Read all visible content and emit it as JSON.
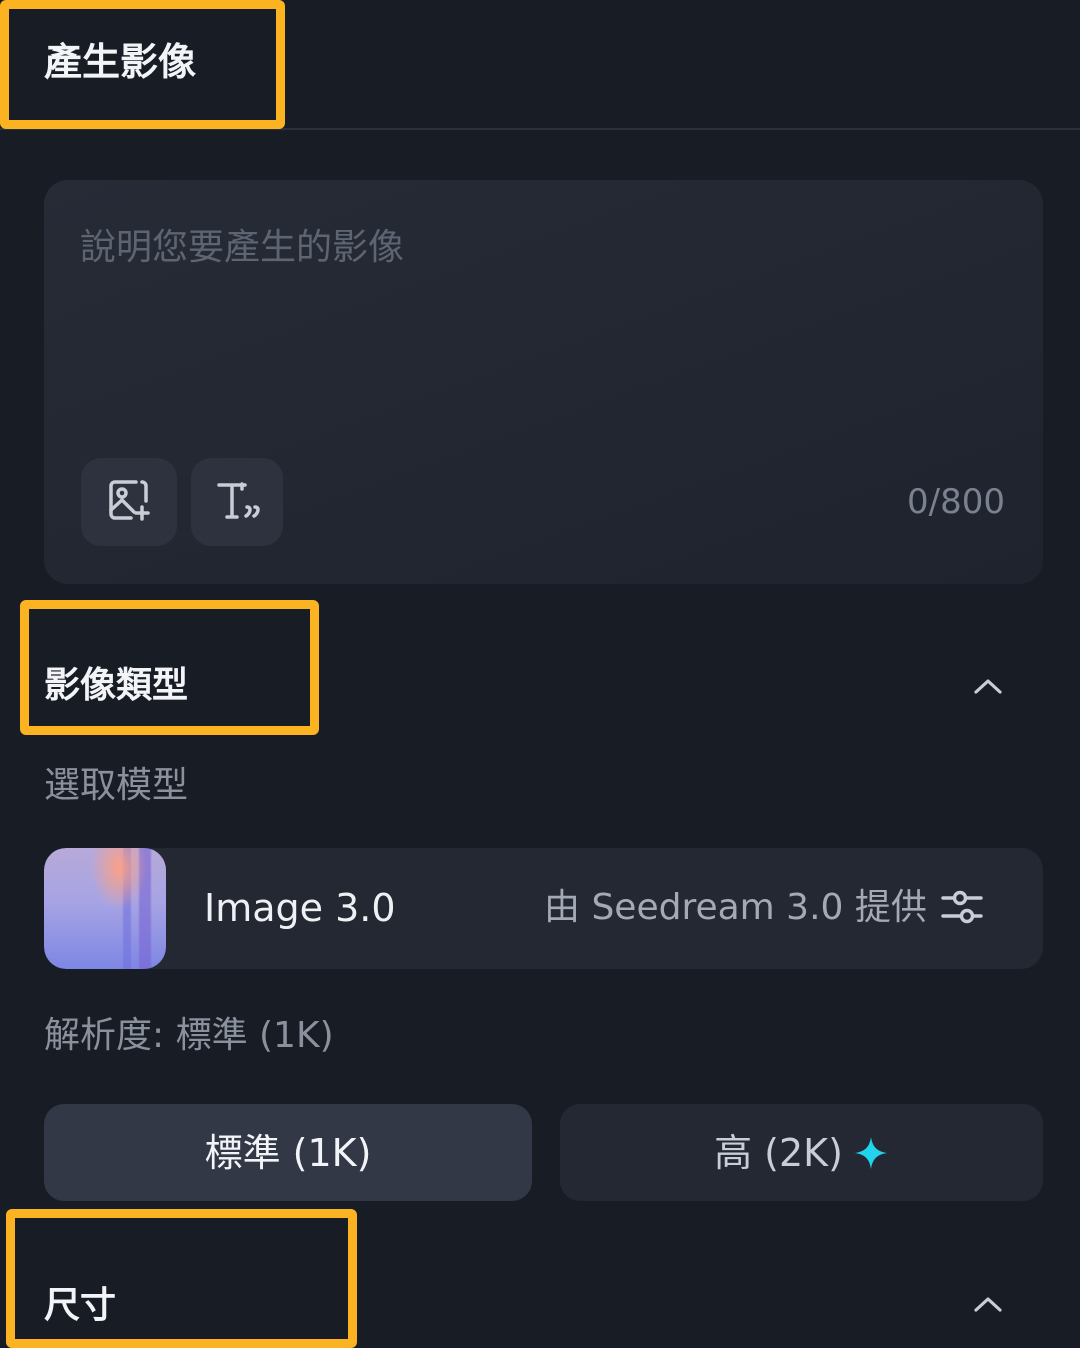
{
  "header": {
    "title": "產生影像"
  },
  "prompt": {
    "placeholder": "說明您要產生的影像",
    "value": "",
    "char_count": "0/800",
    "tools": [
      {
        "name": "add-image-reference",
        "icon": "image-plus-icon"
      },
      {
        "name": "text-style",
        "icon": "text-quote-icon"
      }
    ]
  },
  "image_type": {
    "title": "影像類型",
    "model_label": "選取模型",
    "model": {
      "name": "Image 3.0",
      "provider": "由 Seedream 3.0 提供",
      "settings_icon": "sliders-icon"
    },
    "resolution_label": "解析度: 標準 (1K)",
    "resolution_options": [
      {
        "label": "標準 (1K)",
        "selected": true
      },
      {
        "label": "高 (2K)",
        "selected": false,
        "badge_icon": "sparkle-icon"
      }
    ]
  },
  "size": {
    "title": "尺寸"
  },
  "colors": {
    "background": "#181c25",
    "card": "#232833",
    "highlight": "#fbb321",
    "sparkle": "#22d3ee"
  }
}
